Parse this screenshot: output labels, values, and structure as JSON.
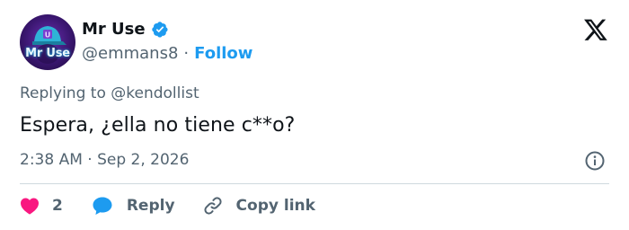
{
  "user": {
    "avatar_text": "Mr Use",
    "name": "Mr Use",
    "handle": "@emmans8",
    "separator": "·",
    "follow_label": "Follow"
  },
  "tweet": {
    "replying_prefix": "Replying to",
    "replying_to": "@kendollist",
    "text": "Espera, ¿ella no tiene c**o?",
    "time": "2:38 AM",
    "date_separator": "·",
    "date": "Sep 2, 2026"
  },
  "actions": {
    "like_count": "2",
    "reply_label": "Reply",
    "copy_label": "Copy link"
  },
  "colors": {
    "accent": "#1d9bf0",
    "like": "#f91880",
    "muted": "#536471",
    "text": "#0f1419"
  },
  "icons": [
    "verified-badge-icon",
    "x-logo-icon",
    "info-icon",
    "heart-icon",
    "reply-bubble-icon",
    "link-icon"
  ]
}
